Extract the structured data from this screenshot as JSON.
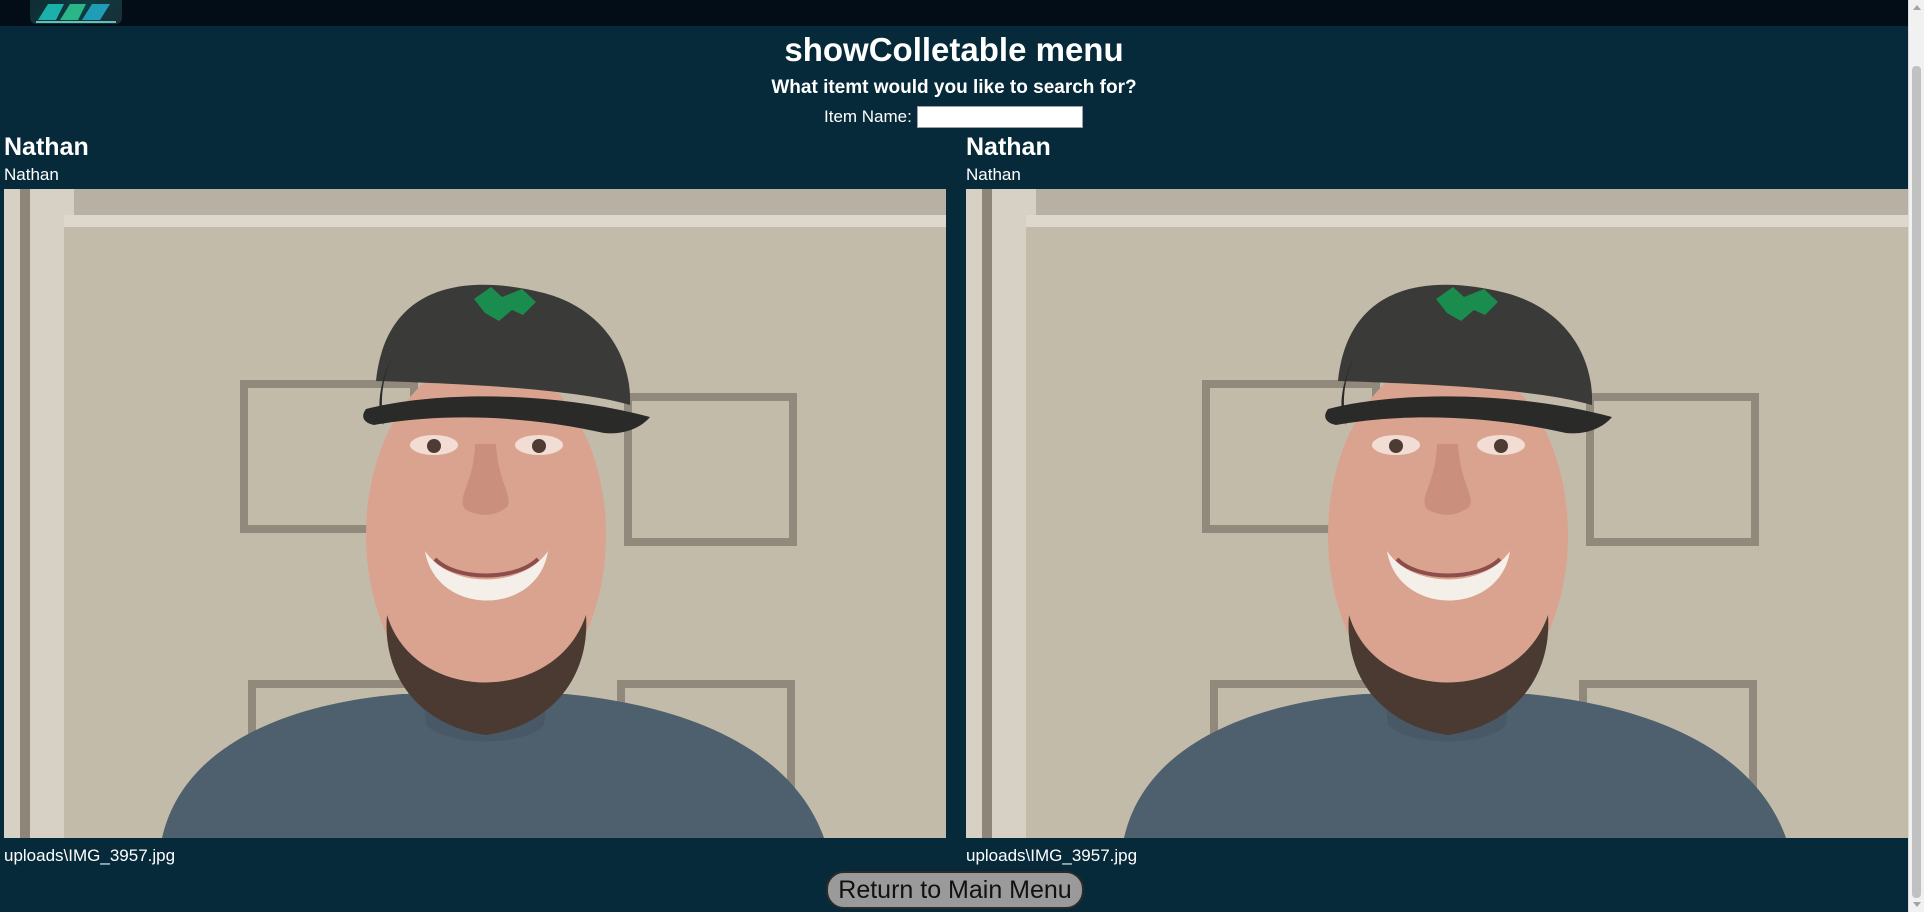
{
  "header": {
    "logo_icon": "app-logo-icon"
  },
  "page": {
    "title": "showColletable menu",
    "search_prompt": "What itemt would you like to search for?",
    "search_label": "Item Name:",
    "search_value": ""
  },
  "items": [
    {
      "title": "Nathan",
      "subtitle": "Nathan",
      "image_path": "uploads\\IMG_3957.jpg"
    },
    {
      "title": "Nathan",
      "subtitle": "Nathan",
      "image_path": "uploads\\IMG_3957.jpg"
    }
  ],
  "footer": {
    "return_label": "Return to Main Menu"
  },
  "colors": {
    "background": "#062a3a",
    "topbar": "#020d18",
    "button": "#9a9a9a"
  }
}
